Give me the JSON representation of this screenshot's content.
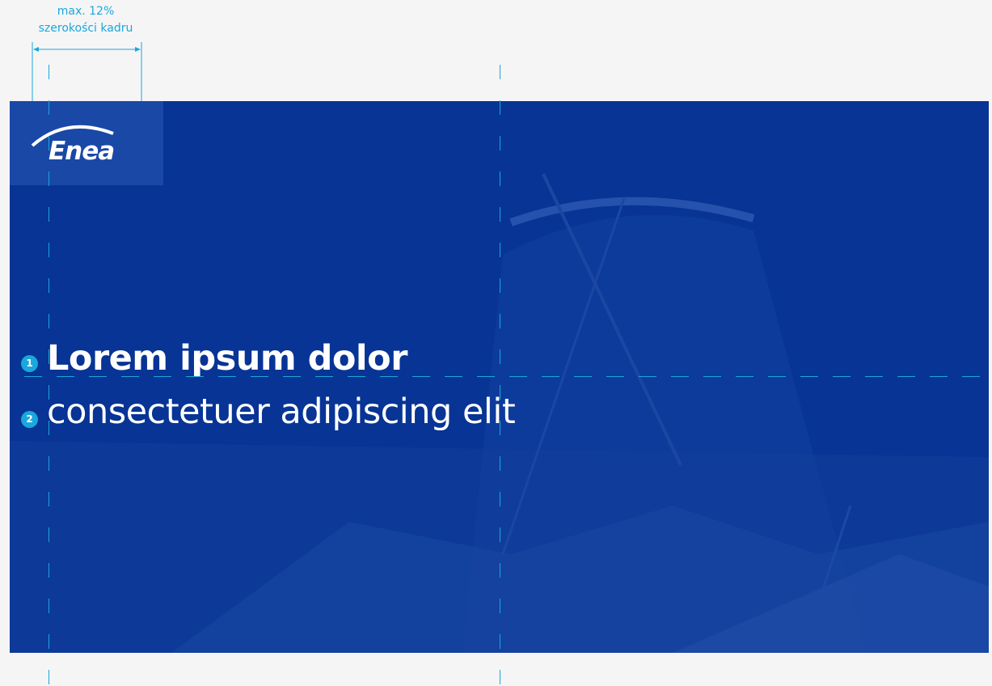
{
  "annotation": {
    "line1": "max. 12%",
    "line2": "szerokości kadru"
  },
  "logo": {
    "text": "Enea"
  },
  "headline": {
    "marker": "1",
    "text": "Lorem ipsum dolor"
  },
  "subline": {
    "marker": "2",
    "text": "consectetuer adipiscing elit"
  },
  "colors": {
    "banner": "#073495",
    "guide": "#1aa7dc",
    "background": "#f5f5f5"
  }
}
